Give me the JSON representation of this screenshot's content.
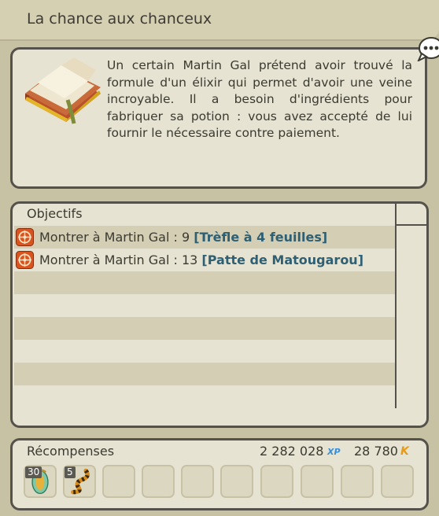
{
  "quest": {
    "title": "La chance aux chanceux",
    "description": "Un certain Martin Gal prétend avoir trouvé la formule d'un élixir qui permet d'avoir une veine incroyable. Il a besoin d'ingrédients pour fabriquer sa potion : vous avez accepté de lui fournir le nécessaire contre paiement."
  },
  "objectives": {
    "header": "Objectifs",
    "items": [
      {
        "text": "Montrer à Martin Gal : 9 ",
        "item": "[Trèfle à 4 feuilles]",
        "icon": "compass-icon"
      },
      {
        "text": "Montrer à Martin Gal : 13 ",
        "item": "[Patte de Matougarou]",
        "icon": "compass-icon"
      }
    ]
  },
  "rewards": {
    "header": "Récompenses",
    "xp": "2 282 028",
    "xp_badge": "XP",
    "kamas": "28 780",
    "kamas_badge": "K",
    "items": [
      {
        "count": "30",
        "icon": "potion-icon"
      },
      {
        "count": "5",
        "icon": "tail-icon"
      }
    ],
    "empty_slots": 8
  },
  "colors": {
    "accent_item": "#2e5f73",
    "xp": "#3a8fd8",
    "kamas": "#e59a18",
    "border": "#54524a"
  }
}
